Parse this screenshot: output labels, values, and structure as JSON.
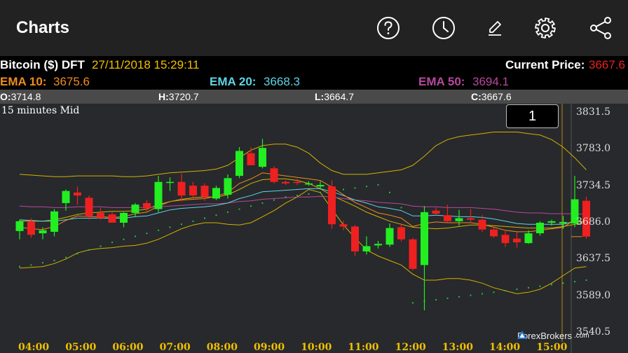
{
  "appbar": {
    "title": "Charts",
    "icons": [
      "help-icon",
      "clock-icon",
      "pencil-icon",
      "gear-icon",
      "share-icon"
    ]
  },
  "info": {
    "symbol": "Bitcoin ($) DFT",
    "datetime": "27/11/2018 15:29:11",
    "current_price_label": "Current Price:",
    "current_price": "3667.6",
    "ema10_label": "EMA 10:",
    "ema10": "3675.6",
    "ema20_label": "EMA 20:",
    "ema20": "3668.3",
    "ema50_label": "EMA 50:",
    "ema50": "3694.1",
    "colors": {
      "ema10": "#f08c1e",
      "ema20": "#5fd4e6",
      "ema50": "#b9479e",
      "symbol_date": "#f0c000",
      "price": "#e82020"
    }
  },
  "ohlc": {
    "o_label": "O:",
    "o": "3714.8",
    "h_label": "H:",
    "h": "3720.7",
    "l_label": "L:",
    "l": "3664.7",
    "c_label": "C:",
    "c": "3667.6"
  },
  "chart": {
    "period": "15 minutes Mid",
    "zoom_value": "1",
    "y_labels": [
      "3831.5",
      "3783.0",
      "3734.5",
      "3686.0",
      "3637.5",
      "3589.0",
      "3540.5"
    ],
    "x_labels": [
      "04:00",
      "05:00",
      "06:00",
      "07:00",
      "08:00",
      "09:00",
      "10:00",
      "11:00",
      "12:00",
      "13:00",
      "14:00",
      "15:00"
    ],
    "watermark": "ForexBrokers",
    "watermark_suffix": ".com"
  },
  "chart_data": {
    "type": "candlestick",
    "ylim": [
      3540.5,
      3831.5
    ],
    "yticks": [
      3831.5,
      3783.0,
      3734.5,
      3686.0,
      3637.5,
      3589.0,
      3540.5
    ],
    "x_labels": [
      "04:00",
      "05:00",
      "06:00",
      "07:00",
      "08:00",
      "09:00",
      "10:00",
      "11:00",
      "12:00",
      "13:00",
      "14:00",
      "15:00"
    ],
    "bar_interval": "15 minutes",
    "colors": {
      "up": "#22ee22",
      "down": "#ee2020",
      "bollinger": "#d4b100",
      "ema10": "#f08c1e",
      "ema20": "#5fd4e6",
      "ema50": "#b9479e",
      "psar": "#20c040"
    },
    "candles": [
      {
        "o": 3675,
        "h": 3690,
        "l": 3664,
        "c": 3688
      },
      {
        "o": 3688,
        "h": 3692,
        "l": 3666,
        "c": 3670
      },
      {
        "o": 3672,
        "h": 3680,
        "l": 3664,
        "c": 3676
      },
      {
        "o": 3674,
        "h": 3704,
        "l": 3668,
        "c": 3701
      },
      {
        "o": 3712,
        "h": 3730,
        "l": 3702,
        "c": 3728
      },
      {
        "o": 3726,
        "h": 3734,
        "l": 3710,
        "c": 3722
      },
      {
        "o": 3719,
        "h": 3722,
        "l": 3690,
        "c": 3694
      },
      {
        "o": 3699,
        "h": 3706,
        "l": 3690,
        "c": 3692
      },
      {
        "o": 3697,
        "h": 3700,
        "l": 3686,
        "c": 3686
      },
      {
        "o": 3686,
        "h": 3700,
        "l": 3680,
        "c": 3699
      },
      {
        "o": 3699,
        "h": 3712,
        "l": 3694,
        "c": 3710
      },
      {
        "o": 3712,
        "h": 3716,
        "l": 3700,
        "c": 3705
      },
      {
        "o": 3704,
        "h": 3748,
        "l": 3700,
        "c": 3740
      },
      {
        "o": 3740,
        "h": 3746,
        "l": 3728,
        "c": 3740
      },
      {
        "o": 3740,
        "h": 3751,
        "l": 3714,
        "c": 3722
      },
      {
        "o": 3735,
        "h": 3740,
        "l": 3719,
        "c": 3722
      },
      {
        "o": 3735,
        "h": 3738,
        "l": 3715,
        "c": 3720
      },
      {
        "o": 3718,
        "h": 3735,
        "l": 3716,
        "c": 3732
      },
      {
        "o": 3723,
        "h": 3750,
        "l": 3718,
        "c": 3745
      },
      {
        "o": 3748,
        "h": 3786,
        "l": 3745,
        "c": 3781
      },
      {
        "o": 3778,
        "h": 3786,
        "l": 3762,
        "c": 3762
      },
      {
        "o": 3760,
        "h": 3797,
        "l": 3758,
        "c": 3785
      },
      {
        "o": 3758,
        "h": 3761,
        "l": 3738,
        "c": 3740
      },
      {
        "o": 3740,
        "h": 3742,
        "l": 3736,
        "c": 3738
      },
      {
        "o": 3740,
        "h": 3744,
        "l": 3736,
        "c": 3739
      },
      {
        "o": 3738,
        "h": 3741,
        "l": 3735,
        "c": 3738
      },
      {
        "o": 3734,
        "h": 3741,
        "l": 3730,
        "c": 3736
      },
      {
        "o": 3734,
        "h": 3742,
        "l": 3678,
        "c": 3684
      },
      {
        "o": 3684,
        "h": 3689,
        "l": 3676,
        "c": 3681
      },
      {
        "o": 3681,
        "h": 3683,
        "l": 3642,
        "c": 3648
      },
      {
        "o": 3648,
        "h": 3668,
        "l": 3644,
        "c": 3655
      },
      {
        "o": 3656,
        "h": 3662,
        "l": 3652,
        "c": 3658
      },
      {
        "o": 3657,
        "h": 3685,
        "l": 3654,
        "c": 3679
      },
      {
        "o": 3680,
        "h": 3684,
        "l": 3661,
        "c": 3664
      },
      {
        "o": 3664,
        "h": 3666,
        "l": 3623,
        "c": 3625
      },
      {
        "o": 3630,
        "h": 3708,
        "l": 3570,
        "c": 3700
      },
      {
        "o": 3702,
        "h": 3706,
        "l": 3696,
        "c": 3698
      },
      {
        "o": 3696,
        "h": 3710,
        "l": 3686,
        "c": 3688
      },
      {
        "o": 3688,
        "h": 3703,
        "l": 3682,
        "c": 3692
      },
      {
        "o": 3692,
        "h": 3704,
        "l": 3686,
        "c": 3690
      },
      {
        "o": 3690,
        "h": 3696,
        "l": 3674,
        "c": 3677
      },
      {
        "o": 3677,
        "h": 3681,
        "l": 3666,
        "c": 3668
      },
      {
        "o": 3670,
        "h": 3676,
        "l": 3654,
        "c": 3659
      },
      {
        "o": 3665,
        "h": 3674,
        "l": 3653,
        "c": 3660
      },
      {
        "o": 3659,
        "h": 3676,
        "l": 3658,
        "c": 3672
      },
      {
        "o": 3672,
        "h": 3688,
        "l": 3669,
        "c": 3686
      },
      {
        "o": 3686,
        "h": 3690,
        "l": 3682,
        "c": 3688
      },
      {
        "o": 3685,
        "h": 3695,
        "l": 3678,
        "c": 3687
      },
      {
        "o": 3685,
        "h": 3748,
        "l": 3680,
        "c": 3717
      },
      {
        "o": 3715,
        "h": 3720.7,
        "l": 3664.7,
        "c": 3667.6
      }
    ],
    "bollinger_upper": [
      3750,
      3749,
      3748,
      3747,
      3747,
      3748,
      3748,
      3748,
      3748,
      3747,
      3747,
      3748,
      3750,
      3752,
      3753,
      3754,
      3755,
      3757,
      3762,
      3772,
      3782,
      3788,
      3790,
      3790,
      3786,
      3778,
      3765,
      3755,
      3750,
      3750,
      3750,
      3752,
      3754,
      3756,
      3762,
      3774,
      3788,
      3796,
      3800,
      3802,
      3804,
      3806,
      3806,
      3806,
      3804,
      3802,
      3796,
      3786,
      3772,
      3756
    ],
    "bollinger_middle": [
      3688,
      3688,
      3688,
      3690,
      3693,
      3697,
      3699,
      3700,
      3701,
      3701,
      3702,
      3704,
      3710,
      3714,
      3717,
      3719,
      3720,
      3720,
      3723,
      3730,
      3738,
      3743,
      3744,
      3744,
      3742,
      3738,
      3731,
      3722,
      3715,
      3708,
      3700,
      3694,
      3688,
      3684,
      3680,
      3679,
      3678,
      3679,
      3681,
      3683,
      3683,
      3682,
      3681,
      3680,
      3679,
      3679,
      3679,
      3681,
      3684,
      3686
    ],
    "bollinger_lower": [
      3626,
      3627,
      3628,
      3632,
      3638,
      3646,
      3650,
      3652,
      3653,
      3655,
      3656,
      3659,
      3664,
      3671,
      3678,
      3683,
      3686,
      3686,
      3684,
      3683,
      3686,
      3694,
      3702,
      3712,
      3720,
      3730,
      3726,
      3704,
      3683,
      3666,
      3650,
      3642,
      3636,
      3630,
      3618,
      3610,
      3610,
      3612,
      3612,
      3610,
      3606,
      3600,
      3596,
      3592,
      3594,
      3598,
      3606,
      3616,
      3626,
      3628
    ],
    "ema10": [
      3680,
      3678,
      3677,
      3681,
      3689,
      3695,
      3694,
      3694,
      3693,
      3694,
      3698,
      3700,
      3708,
      3714,
      3716,
      3717,
      3718,
      3721,
      3726,
      3738,
      3744,
      3752,
      3750,
      3748,
      3746,
      3744,
      3742,
      3733,
      3723,
      3713,
      3706,
      3699,
      3696,
      3692,
      3681,
      3685,
      3687,
      3686,
      3686,
      3686,
      3684,
      3680,
      3676,
      3674,
      3674,
      3676,
      3678,
      3680,
      3690,
      3686
    ],
    "ema20": [
      3690,
      3689,
      3688,
      3688,
      3690,
      3692,
      3692,
      3692,
      3692,
      3692,
      3694,
      3695,
      3699,
      3703,
      3705,
      3706,
      3707,
      3709,
      3712,
      3718,
      3722,
      3727,
      3728,
      3729,
      3730,
      3731,
      3731,
      3727,
      3722,
      3716,
      3712,
      3707,
      3705,
      3702,
      3695,
      3695,
      3696,
      3695,
      3694,
      3694,
      3693,
      3691,
      3688,
      3685,
      3684,
      3684,
      3684,
      3684,
      3688,
      3686
    ],
    "ema50": [
      3708,
      3707,
      3707,
      3706,
      3706,
      3707,
      3707,
      3707,
      3706,
      3706,
      3706,
      3706,
      3707,
      3708,
      3709,
      3710,
      3711,
      3711,
      3712,
      3714,
      3715,
      3717,
      3718,
      3719,
      3720,
      3720,
      3721,
      3720,
      3718,
      3716,
      3715,
      3713,
      3712,
      3711,
      3708,
      3707,
      3707,
      3706,
      3706,
      3706,
      3705,
      3704,
      3702,
      3700,
      3699,
      3699,
      3698,
      3698,
      3698,
      3697
    ],
    "psar": [
      3628,
      3630,
      3633,
      3636,
      3640,
      3645,
      3650,
      3655,
      3660,
      3664,
      3668,
      3672,
      3676,
      3680,
      3684,
      3688,
      3692,
      3696,
      3700,
      3704,
      3708,
      3712,
      3716,
      3720,
      3722,
      3724,
      3726,
      3728,
      3730,
      3732,
      3734,
      3736,
      3726,
      3706,
      3580,
      3582,
      3584,
      3586,
      3588,
      3590,
      3592,
      3594,
      3596,
      3598,
      3600,
      3602,
      3604,
      3606,
      3608,
      3610
    ]
  }
}
